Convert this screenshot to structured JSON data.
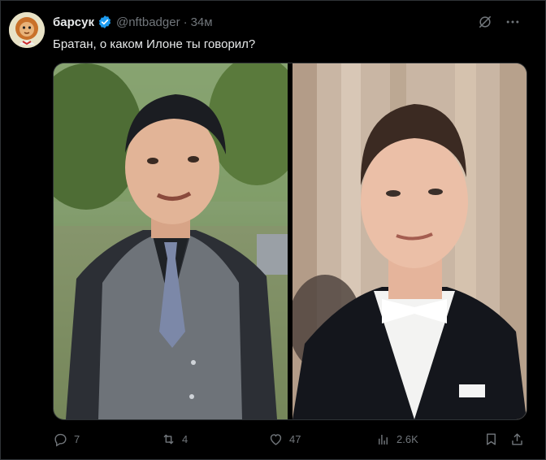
{
  "tweet": {
    "author": {
      "display_name": "барсук",
      "handle": "@nftbadger",
      "verified": true,
      "avatar_icon": "cartoon-lion-avatar"
    },
    "separator": "·",
    "timestamp": "34м",
    "text": "Братан, о каком Илоне ты говорил?",
    "top_actions": [
      {
        "icon": "grok-icon"
      },
      {
        "icon": "more-icon"
      }
    ],
    "media": [
      {
        "alt_kind": "photo",
        "description_icon": "man-in-gray-vest-photo"
      },
      {
        "alt_kind": "photo",
        "description_icon": "man-in-tuxedo-photo"
      }
    ],
    "actions": {
      "reply_count": "7",
      "retweet_count": "4",
      "like_count": "47",
      "views_count": "2.6K"
    }
  },
  "colors": {
    "background": "#000000",
    "text_primary": "#e7e9ea",
    "text_secondary": "#71767b",
    "verified_blue": "#1d9bf0",
    "border": "#2f3336"
  }
}
